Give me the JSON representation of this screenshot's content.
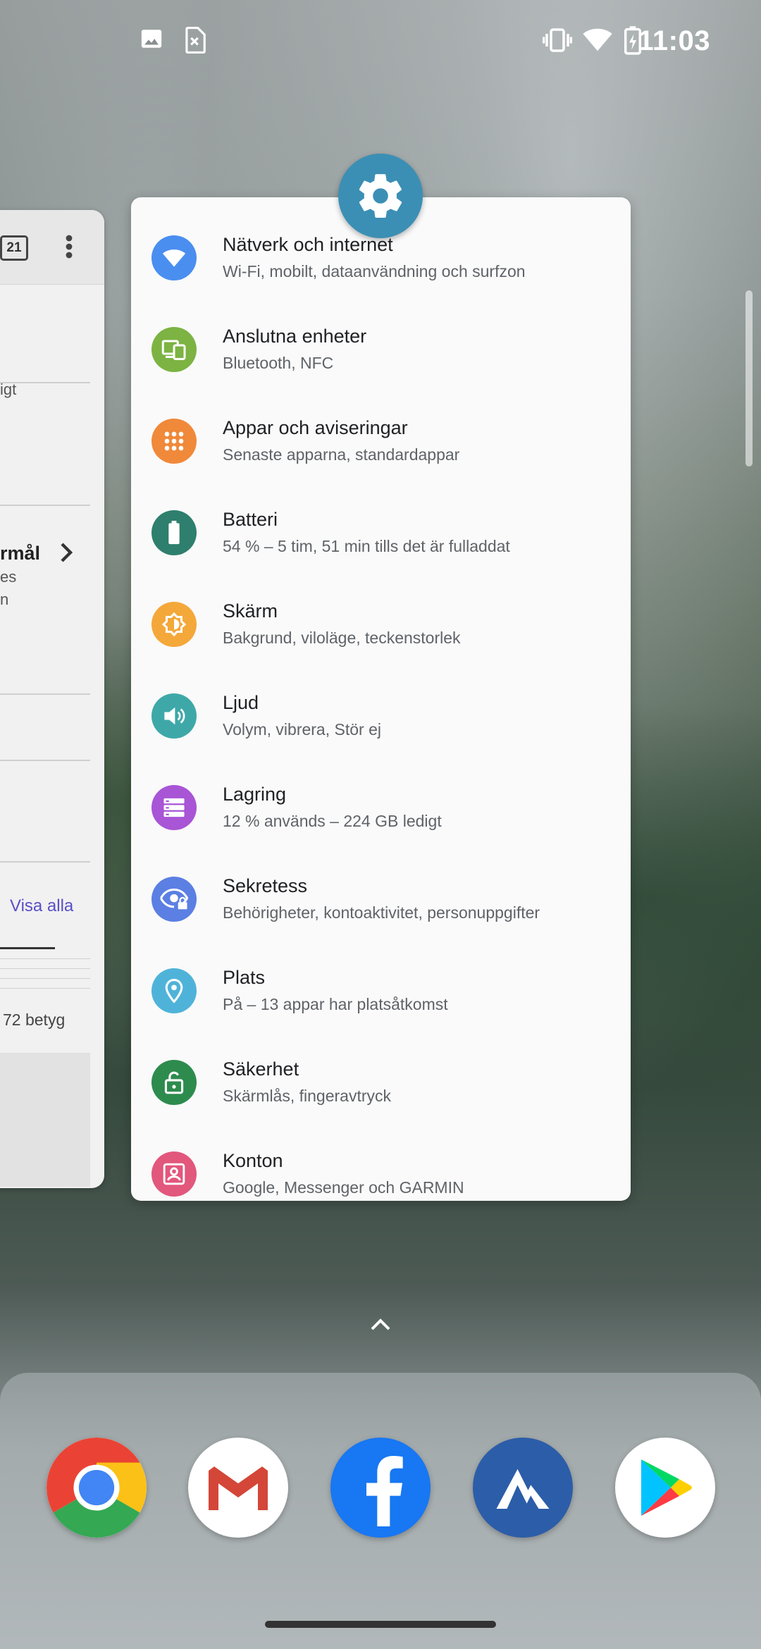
{
  "status_bar": {
    "time": "11:03",
    "left_icons": [
      "image-notification-icon",
      "no-sim-icon"
    ],
    "right_icons": [
      "vibrate-icon",
      "wifi-icon",
      "battery-charging-icon"
    ]
  },
  "left_card": {
    "badge": "21",
    "snippets": [
      "igt",
      "rmål",
      "es",
      "n",
      "Visa alla",
      "72 betyg"
    ]
  },
  "settings_card": {
    "app_icon": "settings-gear-icon",
    "items": [
      {
        "title": "Nätverk och internet",
        "subtitle": "Wi-Fi, mobilt, dataanvändning och surfzon",
        "icon": "wifi-icon",
        "color": "#4a8ef0"
      },
      {
        "title": "Anslutna enheter",
        "subtitle": "Bluetooth, NFC",
        "icon": "connected-devices-icon",
        "color": "#7cb342"
      },
      {
        "title": "Appar och aviseringar",
        "subtitle": "Senaste apparna, standardappar",
        "icon": "apps-grid-icon",
        "color": "#f0893a"
      },
      {
        "title": "Batteri",
        "subtitle": "54 % – 5 tim, 51 min tills det är fulladdat",
        "icon": "battery-icon",
        "color": "#2e7f6d"
      },
      {
        "title": "Skärm",
        "subtitle": "Bakgrund, viloläge, teckenstorlek",
        "icon": "brightness-icon",
        "color": "#f4a83a"
      },
      {
        "title": "Ljud",
        "subtitle": "Volym, vibrera, Stör ej",
        "icon": "volume-icon",
        "color": "#3ea8a8"
      },
      {
        "title": "Lagring",
        "subtitle": "12 % används – 224 GB ledigt",
        "icon": "storage-icon",
        "color": "#a855d6"
      },
      {
        "title": "Sekretess",
        "subtitle": "Behörigheter, kontoaktivitet, personuppgifter",
        "icon": "privacy-eye-icon",
        "color": "#5b7fe3"
      },
      {
        "title": "Plats",
        "subtitle": "På – 13 appar har platsåtkomst",
        "icon": "location-pin-icon",
        "color": "#4fb3d9"
      },
      {
        "title": "Säkerhet",
        "subtitle": "Skärmlås, fingeravtryck",
        "icon": "lock-open-icon",
        "color": "#2e8b4e"
      },
      {
        "title": "Konton",
        "subtitle": "Google, Messenger och GARMIN",
        "icon": "account-icon",
        "color": "#e2577c"
      }
    ]
  },
  "dock": {
    "apps": [
      "chrome-icon",
      "gmail-icon",
      "facebook-icon",
      "nordvpn-icon",
      "play-store-icon"
    ]
  }
}
